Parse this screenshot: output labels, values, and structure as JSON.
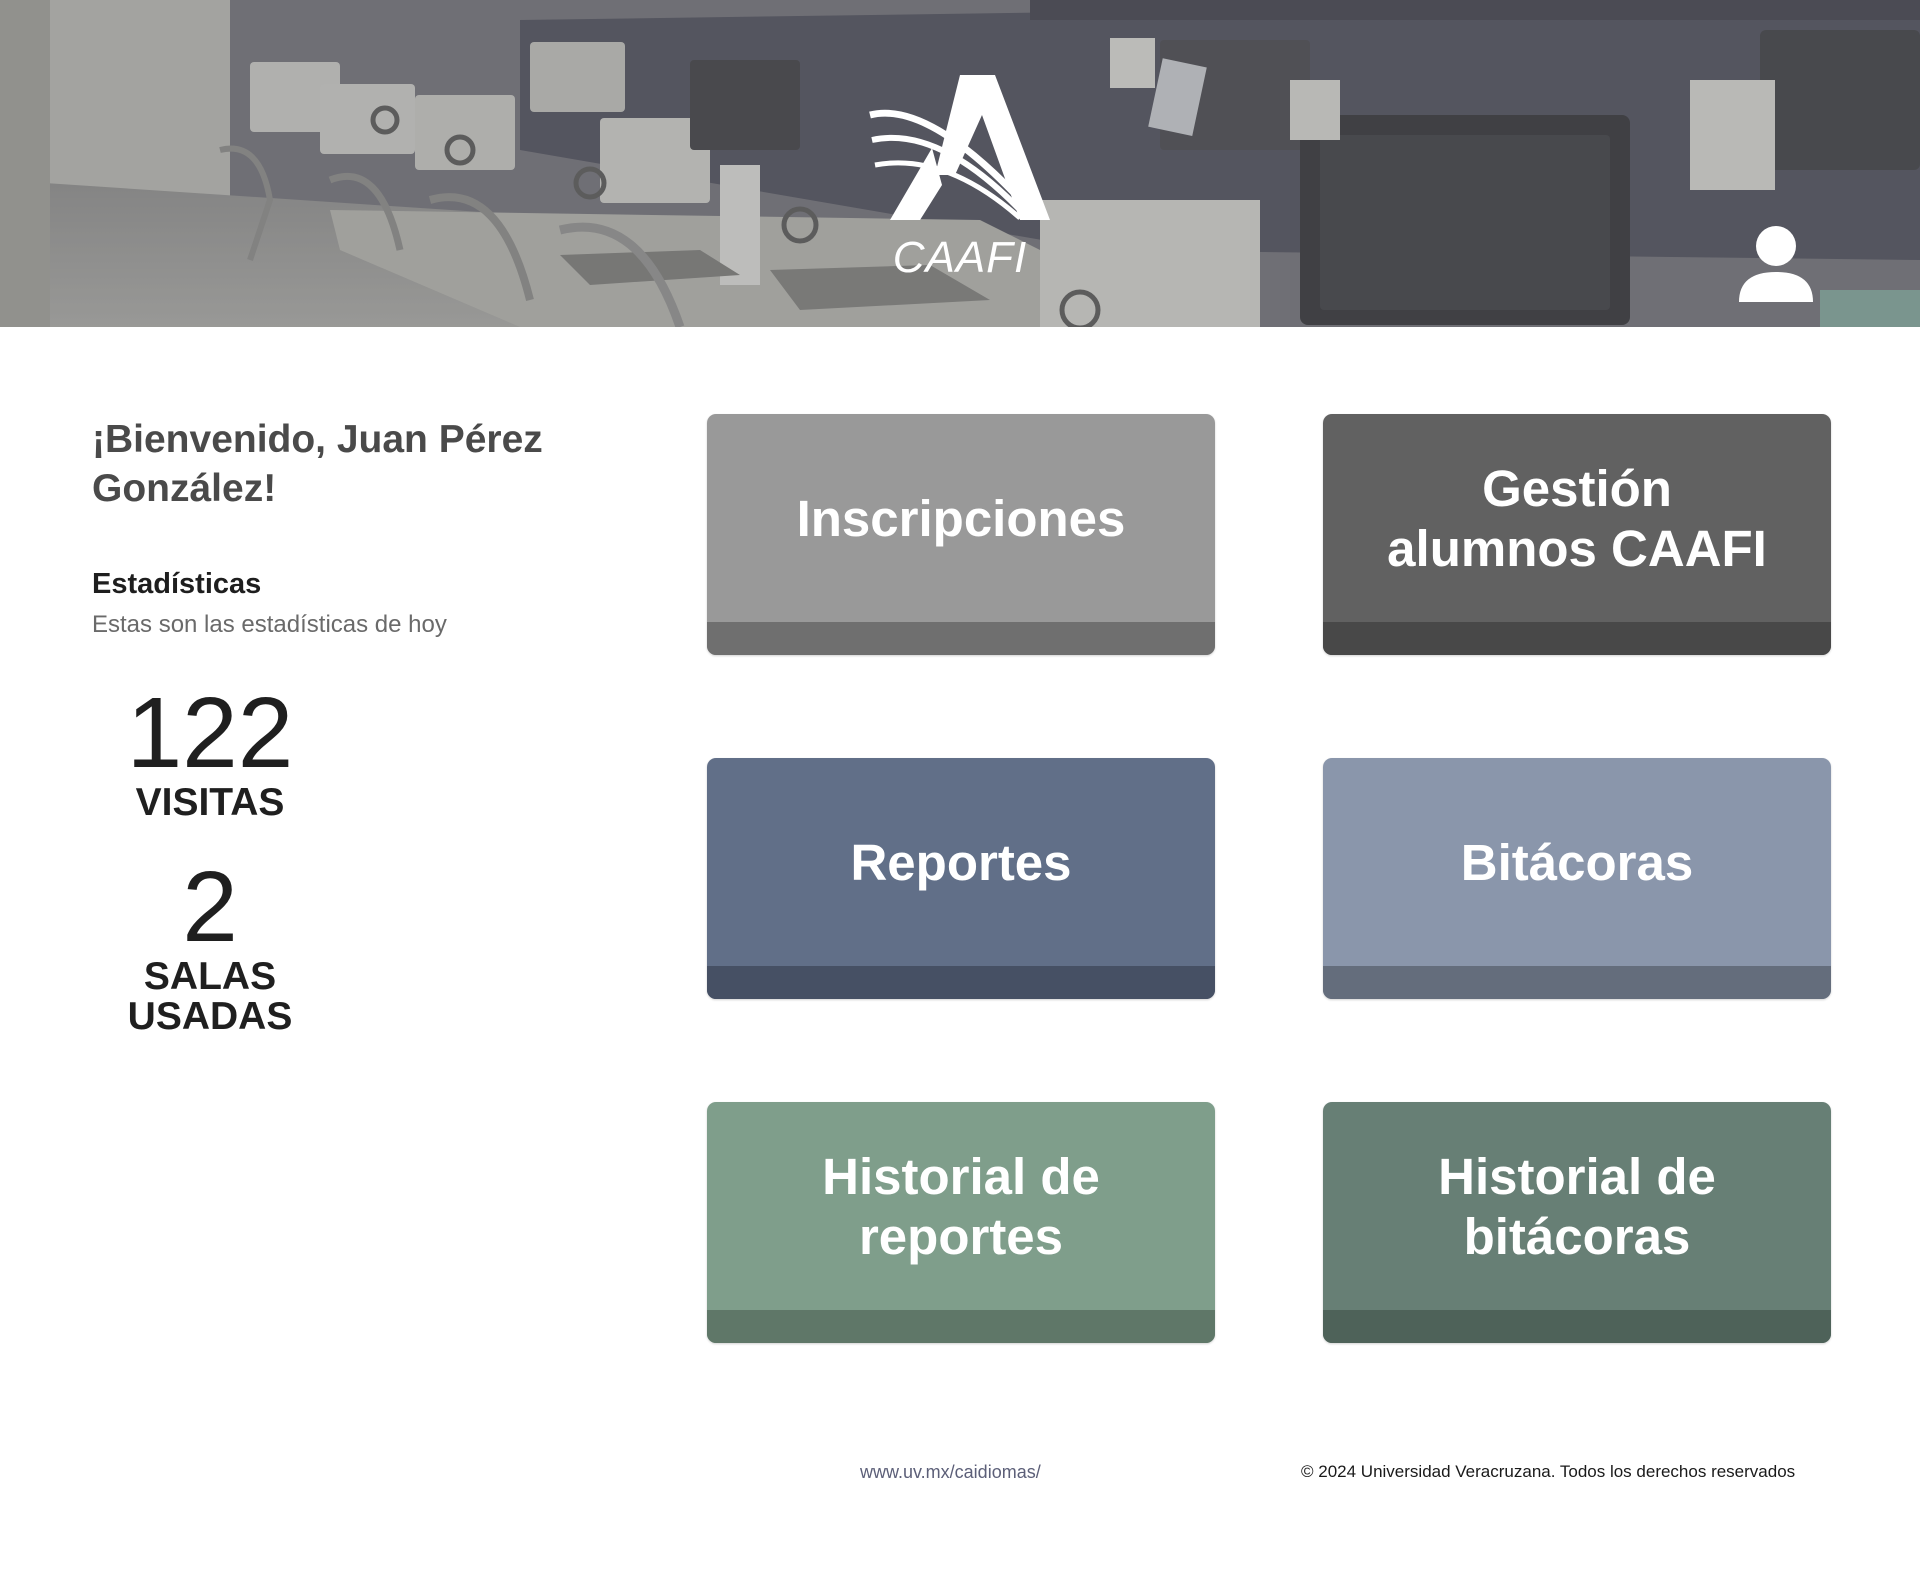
{
  "header": {
    "logo_text": "CAAFI",
    "user_icon": "user-icon"
  },
  "welcome": {
    "message": "¡Bienvenido, Juan Pérez González!"
  },
  "stats": {
    "title": "Estadísticas",
    "subtitle": "Estas son las estadísticas de hoy",
    "visits": {
      "value": "122",
      "label": "VISITAS"
    },
    "rooms": {
      "value": "2",
      "label_line1": "SALAS",
      "label_line2": "USADAS"
    }
  },
  "tiles": [
    {
      "label": "Inscripciones",
      "color": "#999999"
    },
    {
      "label": "Gestión alumnos CAAFI",
      "color": "#616161"
    },
    {
      "label": "Reportes",
      "color": "#616f88"
    },
    {
      "label": "Bitácoras",
      "color": "#8a96ab"
    },
    {
      "label": "Historial de reportes",
      "color": "#7f9e8b"
    },
    {
      "label": "Historial de bitácoras",
      "color": "#677f75"
    }
  ],
  "footer": {
    "link_text": "www.uv.mx/caidiomas/",
    "copyright": "© 2024 Universidad Veracruzana. Todos los derechos reservados"
  }
}
